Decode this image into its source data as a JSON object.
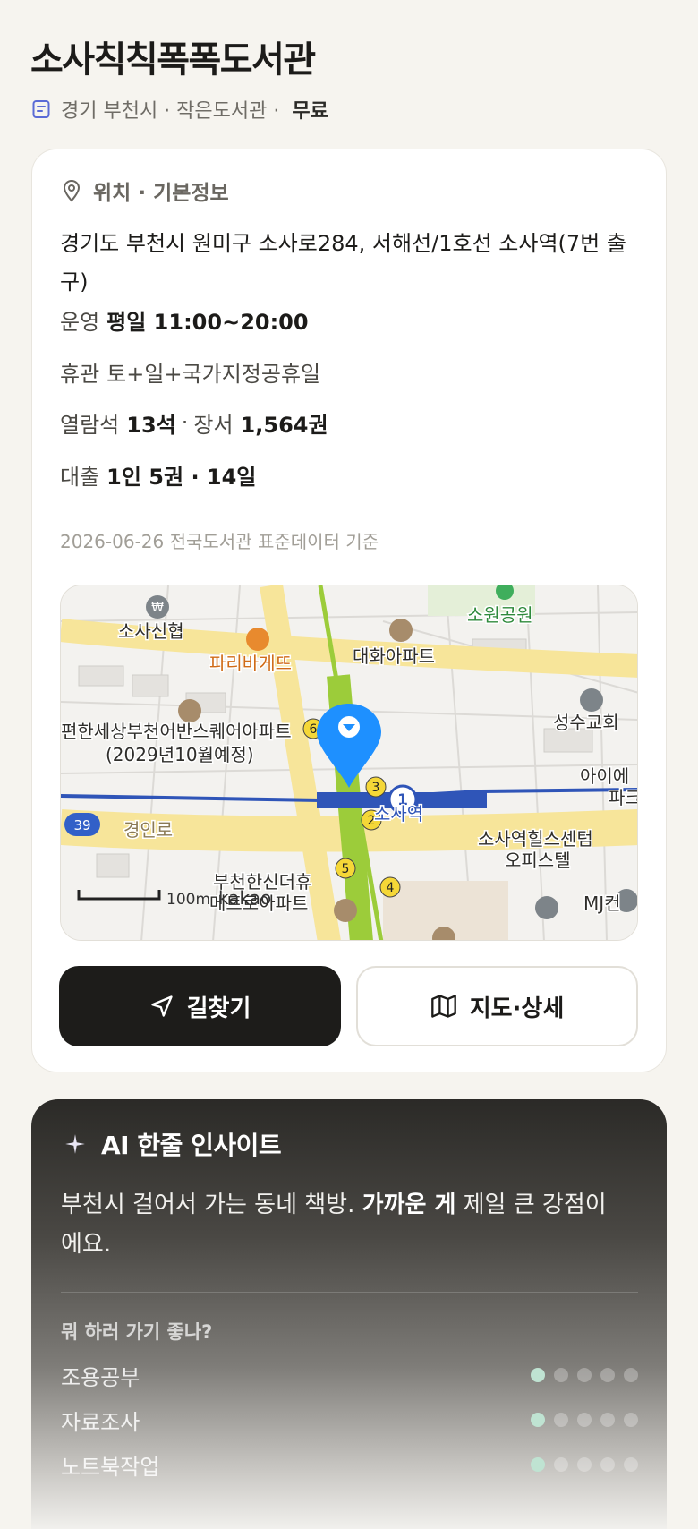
{
  "library": {
    "name": "소사칙칙폭폭도서관",
    "region": "경기 부천시 · 작은도서관 ·",
    "fee": "무료"
  },
  "info": {
    "section_title": "위치 · 기본정보",
    "address": "경기도 부천시 원미구 소사로284, 서해선/1호선 소사역(7번 출구)",
    "hours_label": "운영",
    "hours_value": "평일 11:00~20:00",
    "closed_label": "휴관",
    "closed_value": "토+일+국가지정공휴일",
    "seats_label": "열람석",
    "seats_value": "13석",
    "books_label": "장서",
    "books_value": "1,564권",
    "loan_label": "대출",
    "loan_value": "1인 5권 · 14일",
    "data_basis": "2026-06-26 전국도서관 표준데이터 기준"
  },
  "map": {
    "labels": {
      "bank": "소사신협",
      "bakery": "파리바게뜨",
      "apt1": "대화아파트",
      "park": "소원공원",
      "church": "성수교회",
      "apt2_line1": "편한세상부천어반스퀘어아파트",
      "apt2_line2": "(2029년10월예정)",
      "kids": "아이에",
      "kids2": "파크",
      "station": "소사역",
      "road": "경인로",
      "road_no": "39",
      "office_line1": "소사역힐스센텀",
      "office_line2": "오피스텔",
      "apt3_line1": "부천한신더휴",
      "apt3_line2": "메트로아파트",
      "scale": "100m",
      "brand": "kakao",
      "mj": "MJ컨",
      "line_no": "1",
      "exit2": "2",
      "exit3": "3",
      "exit4": "4",
      "exit5": "5",
      "exit6": "6"
    }
  },
  "actions": {
    "directions": "길찾기",
    "map_detail": "지도·상세"
  },
  "ai": {
    "title": "AI 한줄 인사이트",
    "text_a": "부천시 걸어서 가는 동네 책방. ",
    "text_b": "가까운 게",
    "text_c": " 제일 큰 강점이에요.",
    "question": "뭐 하러 가기 좋나?",
    "ratings": [
      {
        "label": "조용공부",
        "score": 1,
        "max": 5
      },
      {
        "label": "자료조사",
        "score": 1,
        "max": 5
      },
      {
        "label": "노트북작업",
        "score": 1,
        "max": 5
      }
    ]
  },
  "colors": {
    "primary_dark": "#1d1c1a",
    "rating_on": "#bfe3d2",
    "marker": "#1e90ff",
    "line1": "#2f55b8",
    "seohae_line": "#8cc63f"
  }
}
